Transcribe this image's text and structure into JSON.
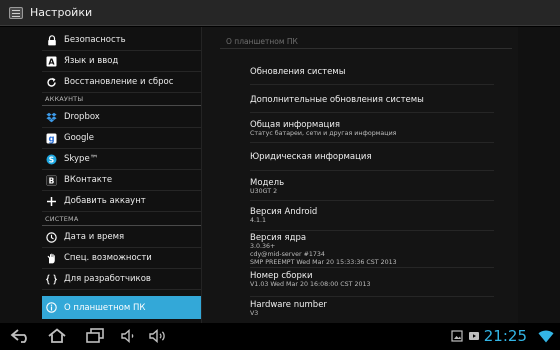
{
  "app": {
    "title": "Настройки",
    "icon": "settings-icon"
  },
  "sidebar": {
    "items": [
      {
        "key": "security",
        "label": "Безопасность",
        "icon": "lock-icon"
      },
      {
        "key": "language",
        "label": "Язык и ввод",
        "icon": "keyboard-a-icon"
      },
      {
        "key": "backup",
        "label": "Восстановление и сброс",
        "icon": "refresh-icon"
      }
    ],
    "accounts_header": "АККАУНТЫ",
    "accounts": [
      {
        "key": "dropbox",
        "label": "Dropbox",
        "icon": "dropbox-icon"
      },
      {
        "key": "google",
        "label": "Google",
        "icon": "google-g-icon"
      },
      {
        "key": "skype",
        "label": "Skype™",
        "icon": "skype-icon"
      },
      {
        "key": "vkontakte",
        "label": "ВКонтакте",
        "icon": "vk-icon"
      },
      {
        "key": "add-account",
        "label": "Добавить аккаунт",
        "icon": "plus-icon"
      }
    ],
    "system_header": "СИСТЕМА",
    "system": [
      {
        "key": "datetime",
        "label": "Дата и время",
        "icon": "clock-icon"
      },
      {
        "key": "accessibility",
        "label": "Спец. возможности",
        "icon": "hand-icon"
      },
      {
        "key": "developer",
        "label": "Для разработчиков",
        "icon": "braces-icon"
      },
      {
        "key": "about",
        "label": "О планшетном ПК",
        "icon": "info-icon",
        "selected": true
      }
    ]
  },
  "about": {
    "header": "О планшетном ПК",
    "system_updates": "Обновления системы",
    "extra_updates": "Дополнительные обновления системы",
    "status_title": "Общая информация",
    "status_sub": "Статус батареи, сети и другая информация",
    "legal": "Юридическая информация",
    "model_title": "Модель",
    "model_value": "U30GT 2",
    "android_title": "Версия Android",
    "android_value": "4.1.1",
    "kernel_title": "Версия ядра",
    "kernel_lines": [
      "3.0.36+",
      "cdy@mid-server #1734",
      "SMP PREEMPT Wed Mar 20 15:33:36 CST 2013"
    ],
    "build_title": "Номер сборки",
    "build_value": "V1.03 Wed Mar 20 16:08:00 CST 2013",
    "hw_title": "Hardware number",
    "hw_value": "V3"
  },
  "navbar": {
    "buttons": [
      "back-icon",
      "home-icon",
      "recent-apps-icon",
      "volume-down-icon",
      "volume-up-icon"
    ],
    "status_icons": [
      "screenshot-icon",
      "media-icon"
    ],
    "time": "21:25",
    "wifi_icon": "wifi-icon",
    "accent": "#33b5e5"
  }
}
